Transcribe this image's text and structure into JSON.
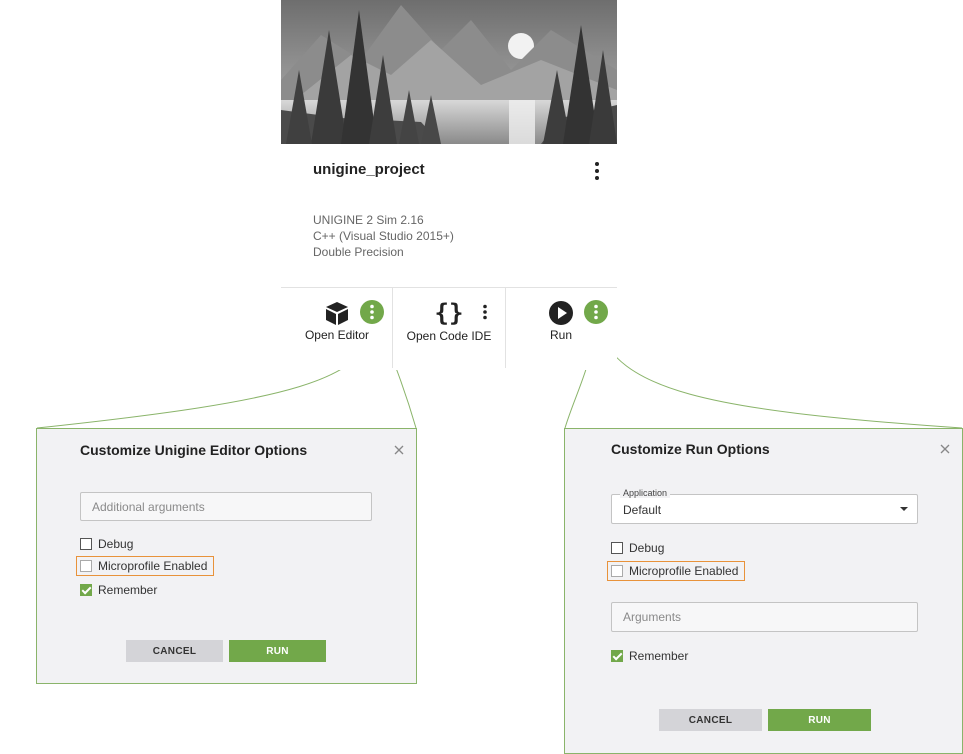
{
  "project": {
    "title": "unigine_project",
    "engine": "UNIGINE 2 Sim 2.16",
    "language": "C++ (Visual Studio 2015+)",
    "precision": "Double Precision",
    "thumbnail_icon": "landscape-thumbnail"
  },
  "actions": {
    "open_editor": {
      "label": "Open Editor",
      "icon": "cube-icon"
    },
    "open_code_ide": {
      "label": "Open Code IDE",
      "icon": "braces-icon"
    },
    "run": {
      "label": "Run",
      "icon": "play-icon"
    }
  },
  "editor_dialog": {
    "title": "Customize Unigine Editor Options",
    "arguments_placeholder": "Additional arguments",
    "debug_label": "Debug",
    "debug_checked": false,
    "microprofile_label": "Microprofile Enabled",
    "microprofile_checked": false,
    "remember_label": "Remember",
    "remember_checked": true,
    "cancel_label": "CANCEL",
    "run_label": "RUN"
  },
  "run_dialog": {
    "title": "Customize Run Options",
    "application_legend": "Application",
    "application_value": "Default",
    "debug_label": "Debug",
    "debug_checked": false,
    "microprofile_label": "Microprofile Enabled",
    "microprofile_checked": false,
    "arguments_placeholder": "Arguments",
    "remember_label": "Remember",
    "remember_checked": true,
    "cancel_label": "CANCEL",
    "run_label": "RUN"
  },
  "colors": {
    "accent_green": "#72a84a",
    "highlight_orange": "#e8923a",
    "dialog_bg": "#f2f2f4"
  }
}
